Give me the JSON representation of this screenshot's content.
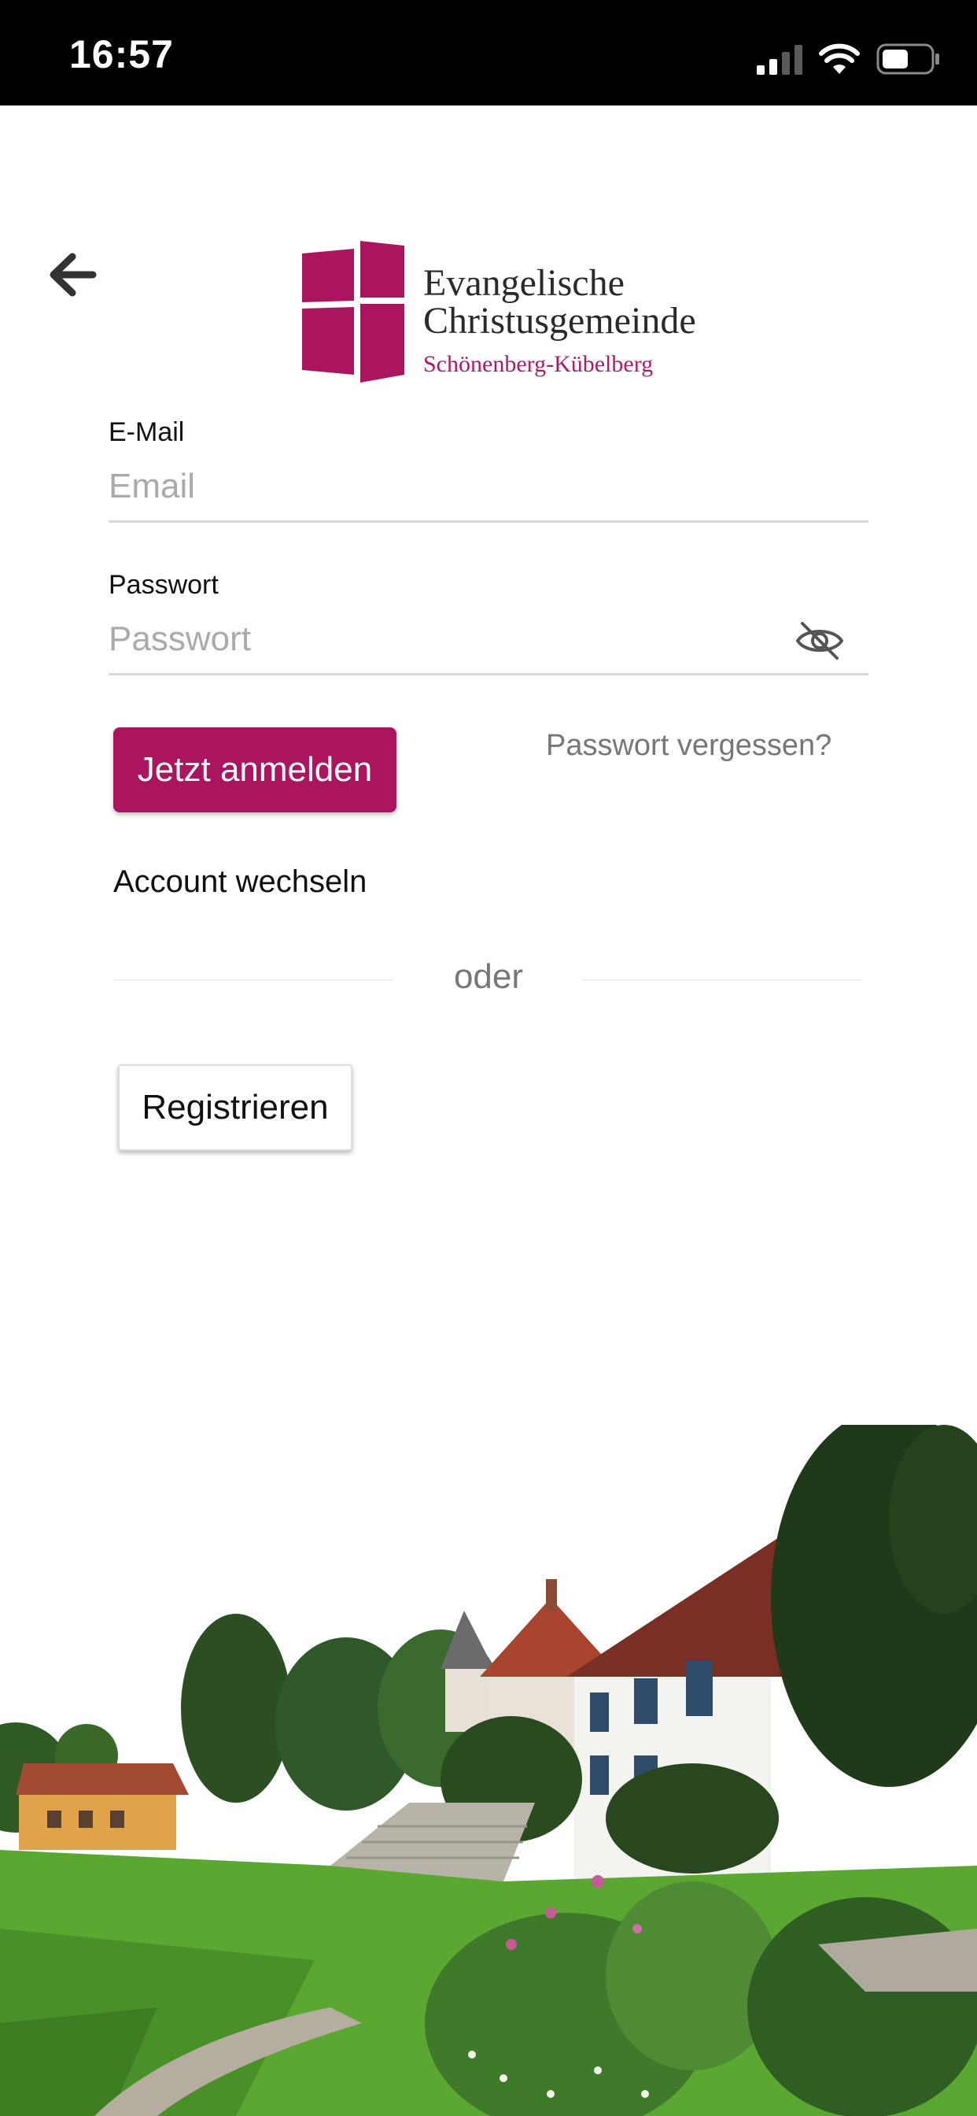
{
  "status_bar": {
    "time": "16:57",
    "icons": [
      "cellular-signal-icon",
      "wifi-icon",
      "battery-icon"
    ]
  },
  "header": {
    "back_icon": "arrow-left-icon"
  },
  "logo": {
    "line1": "Evangelische",
    "line2": "Christusgemeinde",
    "line3": "Schönenberg-Kübelberg",
    "accent_color": "#a81d67"
  },
  "form": {
    "email_label": "E-Mail",
    "email_placeholder": "Email",
    "email_value": "",
    "password_label": "Passwort",
    "password_placeholder": "Passwort",
    "password_value": "",
    "visibility_icon": "eye-slash-icon",
    "login_label": "Jetzt anmelden",
    "forgot_label": "Passwort vergessen?",
    "switch_account_label": "Account wechseln",
    "divider_label": "oder",
    "register_label": "Registrieren"
  },
  "colors": {
    "primary": "#ab1560",
    "status_bar": "#000000",
    "background": "#ffffff"
  }
}
